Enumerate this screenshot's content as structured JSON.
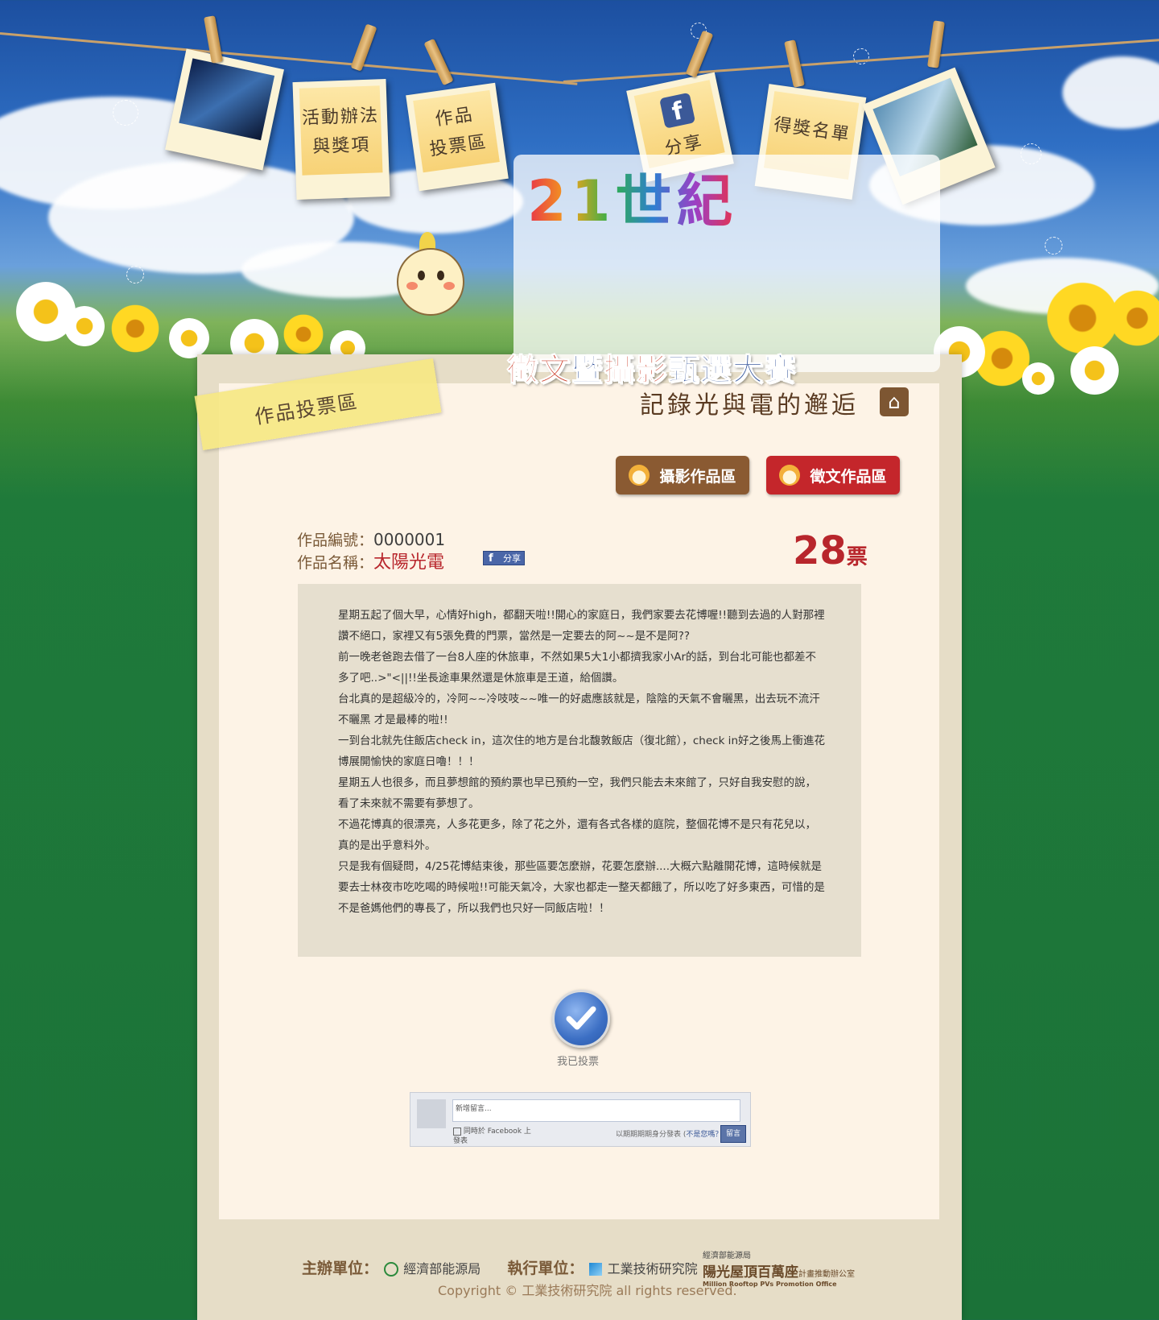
{
  "header": {
    "nav": [
      {
        "label_lines": [
          "活動辦法",
          "與獎項"
        ]
      },
      {
        "label_lines": [
          "作品",
          "投票區"
        ]
      },
      {
        "label": "分享"
      },
      {
        "label": "得獎名單"
      }
    ],
    "logo_title": "太陽光電",
    "logo_prefix": "21世紀",
    "subtitle_part1": "徵文",
    "subtitle_part2": "暨",
    "subtitle_part3": "攝影",
    "subtitle_part4": "甄選大賽",
    "slogan": "記錄光與電的邂逅"
  },
  "section_tape": "作品投票區",
  "category_buttons": {
    "photo": "攝影作品區",
    "essay": "徵文作品區"
  },
  "work": {
    "id_label": "作品編號：",
    "id_value": "0000001",
    "name_label": "作品名稱：",
    "name_value": "太陽光電",
    "share_label": "分享",
    "votes": "28",
    "votes_unit": "票"
  },
  "article": {
    "paragraphs": [
      "星期五起了個大早，心情好high，都翻天啦!!開心的家庭日，我們家要去花博喔!!聽到去過的人對那裡讚不絕口，家裡又有5張免費的門票，當然是一定要去的阿~~是不是阿??",
      "前一晚老爸跑去借了一台8人座的休旅車，不然如果5大1小都擠我家小Ar的話，到台北可能也都差不多了吧..>\"<||!!坐長途車果然還是休旅車是王道，給個讚。",
      "台北真的是超級冷的，冷阿~~冷吱吱~~唯一的好處應該就是，陰陰的天氣不會曬黑，出去玩不流汗不曬黑 才是最棒的啦!!",
      "一到台北就先住飯店check in，這次住的地方是台北馥敦飯店（復北館），check in好之後馬上衝進花博展開愉快的家庭日嚕！！！",
      "星期五人也很多，而且夢想館的預約票也早已預約一空，我們只能去未來館了，只好自我安慰的說，看了未來就不需要有夢想了。",
      "不過花博真的很漂亮，人多花更多，除了花之外，還有各式各樣的庭院，整個花博不是只有花兒以，真的是出乎意料外。",
      "只是我有個疑問，4/25花博結束後，那些區要怎麼辦，花要怎麼辦....大概六點離開花博，這時候就是要去士林夜市吃吃喝的時候啦!!可能天氣冷，大家也都走一整天都餓了，所以吃了好多東西，可惜的是不是爸媽他們的專長了，所以我們也只好一同飯店啦！！"
    ]
  },
  "vote": {
    "status": "我已投票"
  },
  "fb_comment": {
    "placeholder": "新增留言...",
    "checkbox_label": "同時於 Facebook 上發表",
    "note_prefix": "以期期期期身分發表 (",
    "note_link": "不是您嗎？",
    "note_suffix": ")",
    "post_button": "留言"
  },
  "footer": {
    "host_label": "主辦單位：",
    "host_org": "經濟部能源局",
    "exec_label": "執行單位：",
    "exec_org": "工業技術研究院",
    "roof_line1": "經濟部能源局",
    "roof_line2": "陽光屋頂百萬座",
    "roof_line2_small": "計畫推動辦公室",
    "roof_line3": "Million Rooftop PVs Promotion Office",
    "copyright": "Copyright © 工業技術研究院 all rights reserved."
  },
  "colors": {
    "brand_red": "#c4262b",
    "brand_brown": "#8a5a32",
    "panel_bg": "#fdf3e6",
    "article_bg": "#e6dfcf"
  }
}
